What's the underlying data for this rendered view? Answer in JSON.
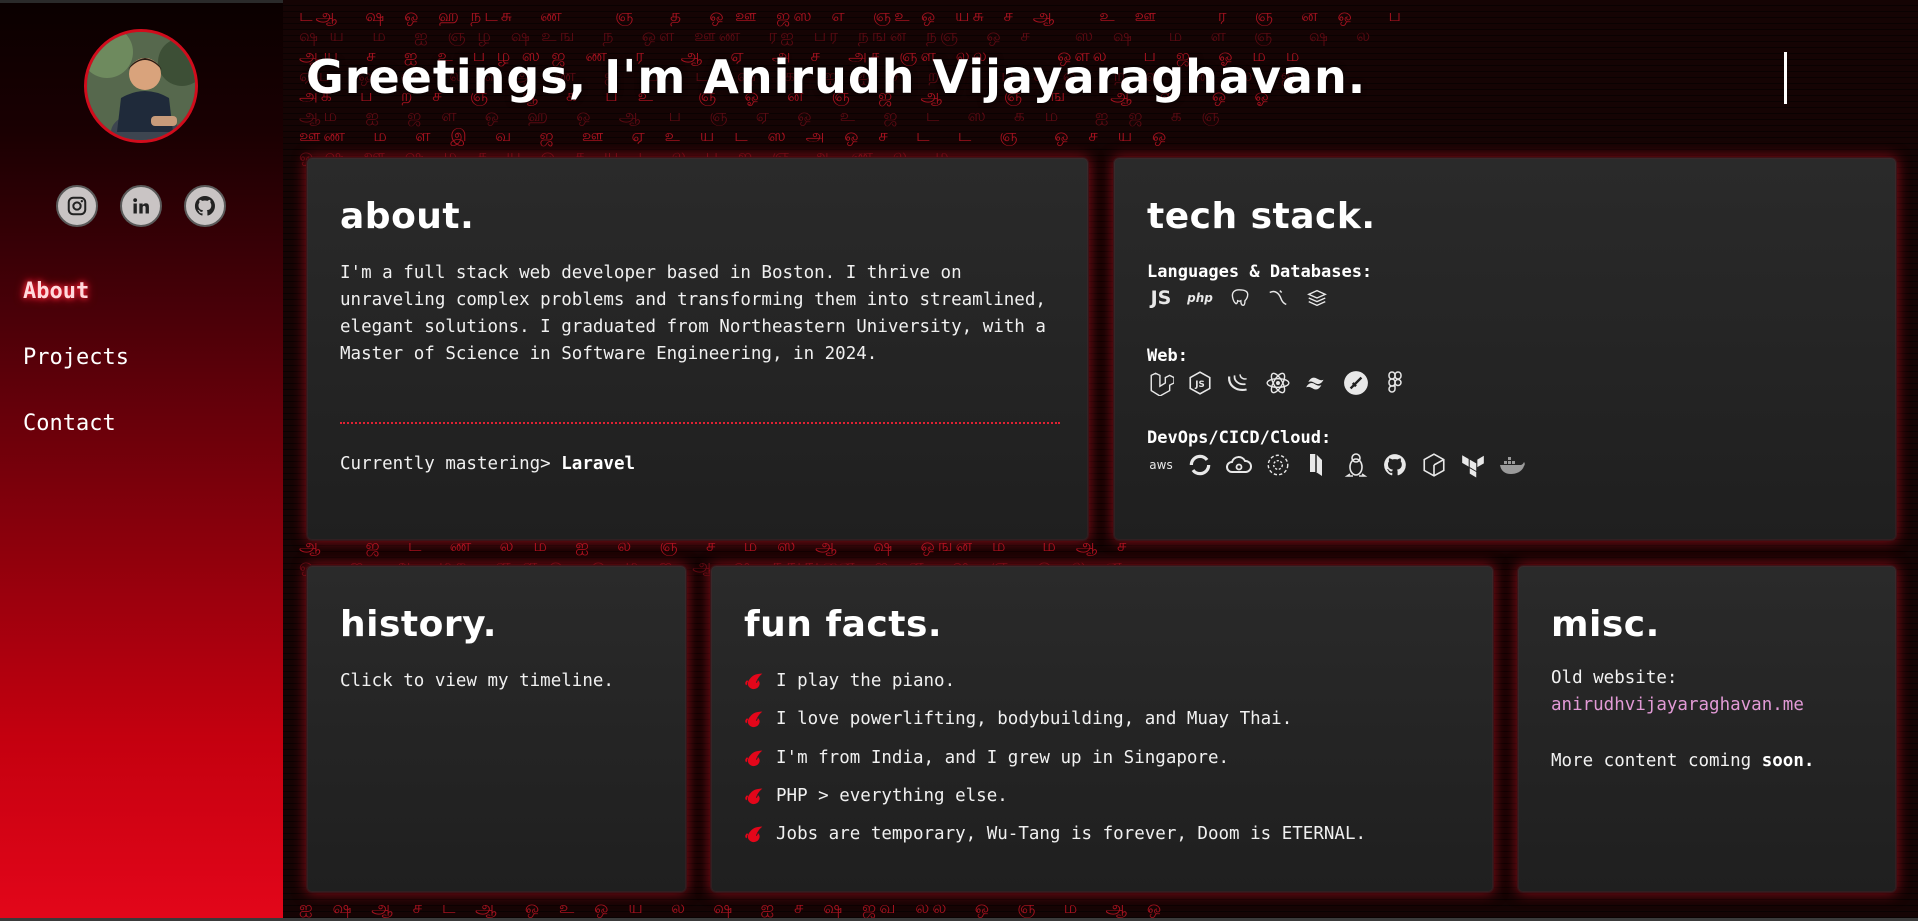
{
  "header": {
    "greeting": "Greetings, I'm Anirudh Vijayaraghavan."
  },
  "sidebar": {
    "nav": [
      {
        "label": "About",
        "active": true
      },
      {
        "label": "Projects",
        "active": false
      },
      {
        "label": "Contact",
        "active": false
      }
    ],
    "social": [
      "instagram-icon",
      "linkedin-icon",
      "github-icon"
    ]
  },
  "about": {
    "title": "about.",
    "text": "I'm a full stack web developer based in Boston. I thrive on unraveling complex problems and transforming them into streamlined, elegant solutions. I graduated from Northeastern University, with a Master of Science in Software Engineering, in 2024.",
    "mastering_prefix": "Currently mastering>",
    "mastering_value": "Laravel"
  },
  "tech": {
    "title": "tech stack.",
    "groups": [
      {
        "label": "Languages & Databases:",
        "icons": [
          "javascript-icon",
          "php-icon",
          "postgresql-icon",
          "mysql-icon",
          "stack-icon"
        ]
      },
      {
        "label": "Web:",
        "icons": [
          "laravel-icon",
          "nodejs-icon",
          "jquery-icon",
          "react-icon",
          "tailwind-icon",
          "codeigniter-icon",
          "figma-icon"
        ]
      },
      {
        "label": "DevOps/CICD/Cloud:",
        "icons": [
          "aws-icon",
          "azure-devops-icon",
          "google-cloud-icon",
          "circleci-icon",
          "bitbucket-icon",
          "linux-icon",
          "github-icon",
          "forge-icon",
          "terraform-icon",
          "docker-icon"
        ]
      }
    ],
    "js_text": "JS",
    "php_text": "php",
    "aws_text": "aws"
  },
  "history": {
    "title": "history.",
    "text": "Click to view my timeline."
  },
  "fun": {
    "title": "fun facts.",
    "facts": [
      "I play the piano.",
      "I love powerlifting, bodybuilding, and Muay Thai.",
      "I'm from India, and I grew up in Singapore.",
      "PHP > everything else.",
      "Jobs are temporary, Wu-Tang is forever, Doom is ETERNAL."
    ]
  },
  "misc": {
    "title": "misc.",
    "old_label": "Old website:",
    "old_link": "anirudhvijayaraghavan.me",
    "more_prefix": "More content coming",
    "more_bold": "soon."
  },
  "colors": {
    "accent": "#e3061a",
    "link": "#e29ad6",
    "card": "#242424"
  }
}
